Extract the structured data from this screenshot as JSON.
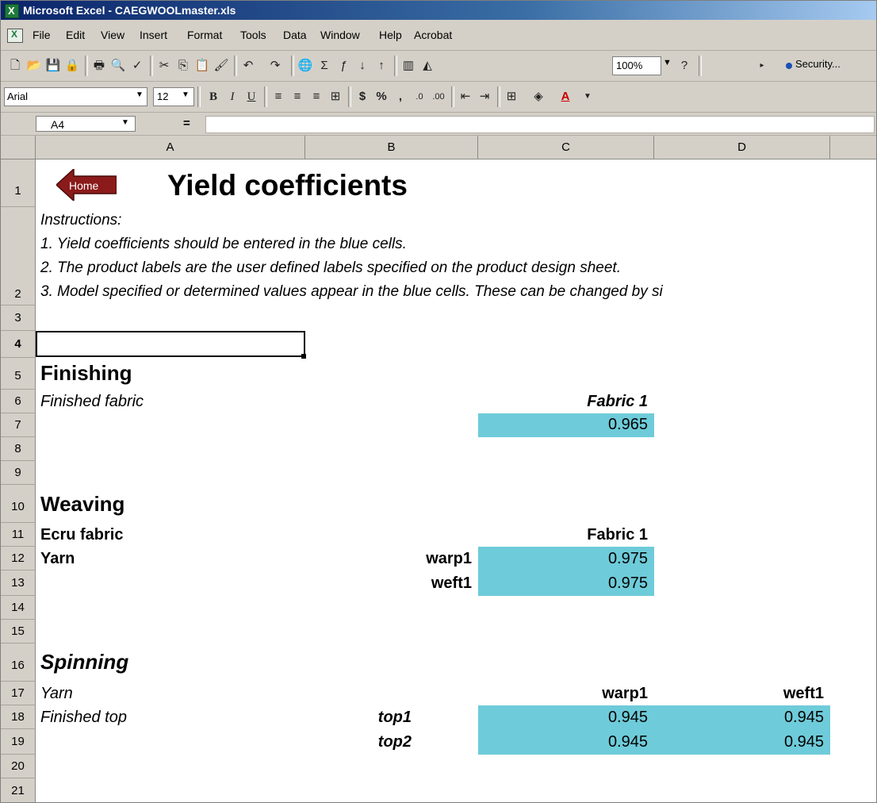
{
  "window": {
    "title": "Microsoft Excel - CAEGWOOLmaster.xls"
  },
  "menu": [
    "File",
    "Edit",
    "View",
    "Insert",
    "Format",
    "Tools",
    "Data",
    "Window",
    "Help",
    "Acrobat"
  ],
  "toolbar": {
    "zoom": "100%",
    "security": "Security..."
  },
  "format_toolbar": {
    "font": "Arial",
    "size": "12"
  },
  "formula_bar": {
    "name_box": "A4",
    "equals": "="
  },
  "columns": [
    "A",
    "B",
    "C",
    "D"
  ],
  "rows": [
    "1",
    "2",
    "3",
    "4",
    "5",
    "6",
    "7",
    "8",
    "9",
    "10",
    "11",
    "12",
    "13",
    "14",
    "15",
    "16",
    "17",
    "18",
    "19",
    "20",
    "21"
  ],
  "sheet": {
    "home_button": "Home",
    "title": "Yield coefficients",
    "instructions_heading": "Instructions:",
    "instruction_1": "1. Yield coefficients should be entered in the blue cells.",
    "instruction_2": "2. The product labels are the user defined labels specified on the product design sheet.",
    "instruction_3": "3. Model specified or determined values appear in the blue cells. These can be changed by si",
    "finishing": {
      "heading": "Finishing",
      "label": "Finished fabric",
      "col_label": "Fabric 1",
      "value": "0.965"
    },
    "weaving": {
      "heading": "Weaving",
      "label": "Ecru fabric",
      "col_label": "Fabric 1",
      "yarn_label": "Yarn",
      "row1_label": "warp1",
      "row1_value": "0.975",
      "row2_label": "weft1",
      "row2_value": "0.975"
    },
    "spinning": {
      "heading": "Spinning",
      "label": "Yarn",
      "col1_label": "warp1",
      "col2_label": "weft1",
      "top_label": "Finished top",
      "row1_label": "top1",
      "row1_values": [
        "0.945",
        "0.945"
      ],
      "row2_label": "top2",
      "row2_values": [
        "0.945",
        "0.945"
      ]
    }
  },
  "colors": {
    "input_cell": "#6ecbd9",
    "home_button": "#8b1a1a"
  }
}
